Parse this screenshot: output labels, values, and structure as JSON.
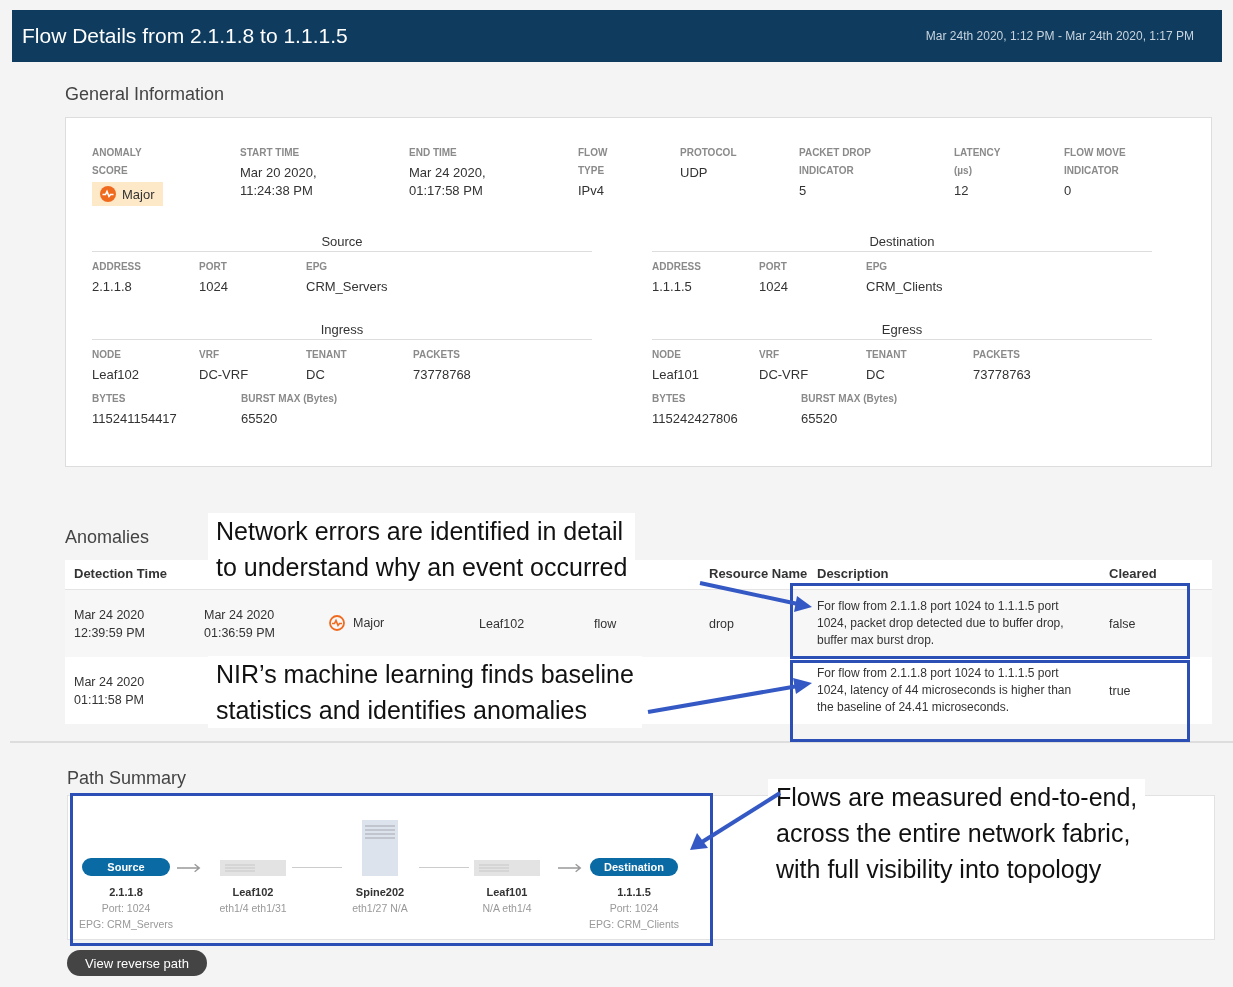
{
  "header": {
    "title": "Flow Details from 2.1.1.8 to 1.1.1.5",
    "time_range": "Mar 24th 2020, 1:12 PM - Mar 24th 2020, 1:17 PM"
  },
  "general": {
    "title": "General Information",
    "summary": [
      {
        "label": "ANOMALY\nSCORE",
        "kind": "severity",
        "value": "Major"
      },
      {
        "label": "START TIME",
        "kind": "text",
        "value": "Mar 20 2020,\n11:24:38 PM"
      },
      {
        "label": "END TIME",
        "kind": "text",
        "value": "Mar 24 2020,\n01:17:58 PM"
      },
      {
        "label": "FLOW\nTYPE",
        "kind": "text",
        "value": "IPv4"
      },
      {
        "label": "PROTOCOL",
        "kind": "text",
        "value": "UDP"
      },
      {
        "label": "PACKET DROP\nINDICATOR",
        "kind": "text",
        "value": "5"
      },
      {
        "label": "LATENCY\n(µs)",
        "kind": "text",
        "value": "12"
      },
      {
        "label": "FLOW MOVE\nINDICATOR",
        "kind": "text",
        "value": "0"
      }
    ],
    "groups": [
      {
        "title": "Source",
        "rows": [
          [
            {
              "label": "ADDRESS",
              "value": "2.1.1.8"
            },
            {
              "label": "PORT",
              "value": "1024"
            },
            {
              "label": "EPG",
              "value": "CRM_Servers"
            }
          ]
        ]
      },
      {
        "title": "Destination",
        "rows": [
          [
            {
              "label": "ADDRESS",
              "value": "1.1.1.5"
            },
            {
              "label": "PORT",
              "value": "1024"
            },
            {
              "label": "EPG",
              "value": "CRM_Clients"
            }
          ]
        ]
      },
      {
        "title": "Ingress",
        "rows": [
          [
            {
              "label": "NODE",
              "value": "Leaf102"
            },
            {
              "label": "VRF",
              "value": "DC-VRF"
            },
            {
              "label": "TENANT",
              "value": "DC"
            },
            {
              "label": "PACKETS",
              "value": "73778768"
            }
          ],
          [
            {
              "label": "BYTES",
              "value": "115241154417"
            },
            {
              "label": "BURST MAX (Bytes)",
              "value": "65520"
            }
          ]
        ]
      },
      {
        "title": "Egress",
        "rows": [
          [
            {
              "label": "NODE",
              "value": "Leaf101"
            },
            {
              "label": "VRF",
              "value": "DC-VRF"
            },
            {
              "label": "TENANT",
              "value": "DC"
            },
            {
              "label": "PACKETS",
              "value": "73778763"
            }
          ],
          [
            {
              "label": "BYTES",
              "value": "115242427806"
            },
            {
              "label": "BURST MAX (Bytes)",
              "value": "65520"
            }
          ]
        ]
      }
    ]
  },
  "anomalies": {
    "title": "Anomalies",
    "columns": [
      "Detection Time",
      null,
      null,
      null,
      null,
      "Resource Name",
      "Description",
      "Cleared"
    ],
    "rows": [
      {
        "detection_time": "Mar 24 2020\n12:39:59 PM",
        "last_detection_time": "Mar 24 2020\n01:36:59 PM",
        "severity": "Major",
        "node": "Leaf102",
        "resource_type": "flow",
        "resource_name": "drop",
        "description": "For flow from 2.1.1.8 port 1024 to 1.1.1.5 port 1024, packet drop detected due to buffer drop, buffer max burst drop.",
        "cleared": "false"
      },
      {
        "detection_time": "Mar 24 2020\n01:11:58 PM",
        "description": "For flow from 2.1.1.8 port 1024 to 1.1.1.5 port 1024, latency of 44 microseconds is higher than the baseline of 24.41 microseconds.",
        "cleared": "true"
      }
    ]
  },
  "path_summary": {
    "title": "Path Summary",
    "nodes": [
      {
        "kind": "endpoint",
        "badge": "Source",
        "name": "2.1.1.8",
        "details": [
          "Port: 1024",
          "EPG: CRM_Servers"
        ]
      },
      {
        "kind": "arrow"
      },
      {
        "kind": "leaf",
        "name": "Leaf102",
        "details": [
          "eth1/4 eth1/31"
        ]
      },
      {
        "kind": "line"
      },
      {
        "kind": "spine",
        "name": "Spine202",
        "details": [
          "eth1/27 N/A"
        ]
      },
      {
        "kind": "line"
      },
      {
        "kind": "leaf",
        "name": "Leaf101",
        "details": [
          "N/A eth1/4"
        ]
      },
      {
        "kind": "arrow"
      },
      {
        "kind": "endpoint",
        "badge": "Destination",
        "name": "1.1.1.5",
        "details": [
          "Port: 1024",
          "EPG: CRM_Clients"
        ]
      }
    ],
    "button": "View reverse path"
  },
  "callouts": [
    "Network errors are identified in detail\nto understand why an event occurred",
    "NIR’s machine learning finds baseline\nstatistics and identifies anomalies",
    "Flows are measured end-to-end,\nacross the entire network fabric,\nwith full visibility into topology"
  ]
}
